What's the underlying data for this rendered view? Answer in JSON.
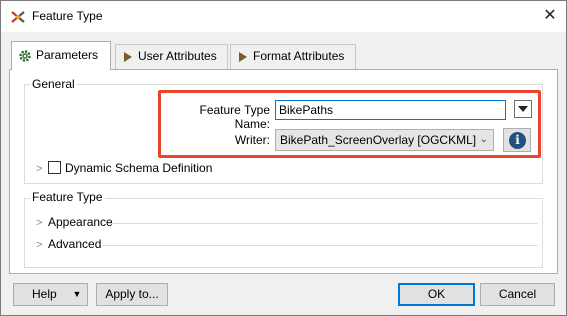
{
  "window": {
    "title": "Feature Type"
  },
  "tabs": [
    {
      "label": "Parameters",
      "icon": "gear-icon",
      "active": true
    },
    {
      "label": "User Attributes",
      "icon": "arrow-right-icon",
      "active": false
    },
    {
      "label": "Format Attributes",
      "icon": "arrow-right-icon",
      "active": false
    }
  ],
  "general": {
    "legend": "General",
    "feature_type_name_label": "Feature Type Name:",
    "feature_type_name_value": "BikePaths",
    "writer_label": "Writer:",
    "writer_value": "BikePath_ScreenOverlay [OGCKML]",
    "dynamic_schema_label": "Dynamic Schema Definition"
  },
  "feature_type": {
    "legend": "Feature Type",
    "sections": [
      "Appearance",
      "Advanced"
    ]
  },
  "buttons": {
    "help": "Help",
    "apply_to": "Apply to...",
    "ok": "OK",
    "cancel": "Cancel"
  },
  "colors": {
    "highlight": "#e8452c",
    "accent": "#0078d7",
    "info": "#24507c",
    "tab_arrow": "#7a5a2a"
  }
}
